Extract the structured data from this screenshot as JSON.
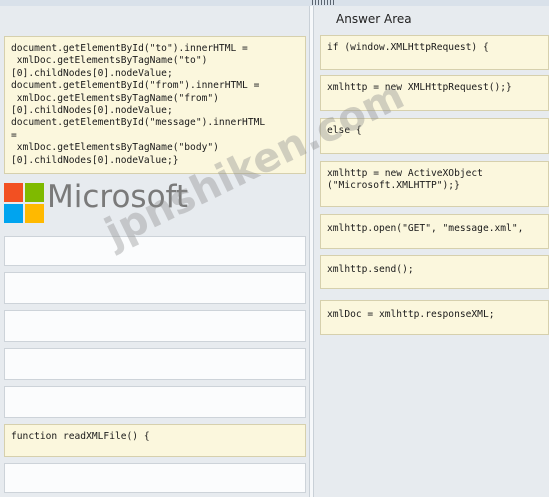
{
  "answer_area": {
    "title": "Answer Area"
  },
  "source_code": {
    "lines": "document.getElementById(\"to\").innerHTML =\n xmlDoc.getElementsByTagName(\"to\")\n[0].childNodes[0].nodeValue;\ndocument.getElementById(\"from\").innerHTML =\n xmlDoc.getElementsByTagName(\"from\")\n[0].childNodes[0].nodeValue;\ndocument.getElementById(\"message\").innerHTML\n=\n xmlDoc.getElementsByTagName(\"body\")\n[0].childNodes[0].nodeValue;}",
    "function_decl": "function readXMLFile() {"
  },
  "answer_items": [
    "if (window.XMLHttpRequest) {",
    "xmlhttp = new XMLHttpRequest();}",
    "else {",
    "xmlhttp = new ActiveXObject\n(\"Microsoft.XMLHTTP\");}",
    "xmlhttp.open(\"GET\", \"message.xml\",",
    "xmlhttp.send();",
    "xmlDoc = xmlhttp.responseXML;"
  ],
  "branding": {
    "logo_word": "Microsoft",
    "logo_colors": [
      "#f25022",
      "#7fba00",
      "#00a4ef",
      "#ffb900"
    ],
    "watermark": "jpnshiken.com"
  }
}
